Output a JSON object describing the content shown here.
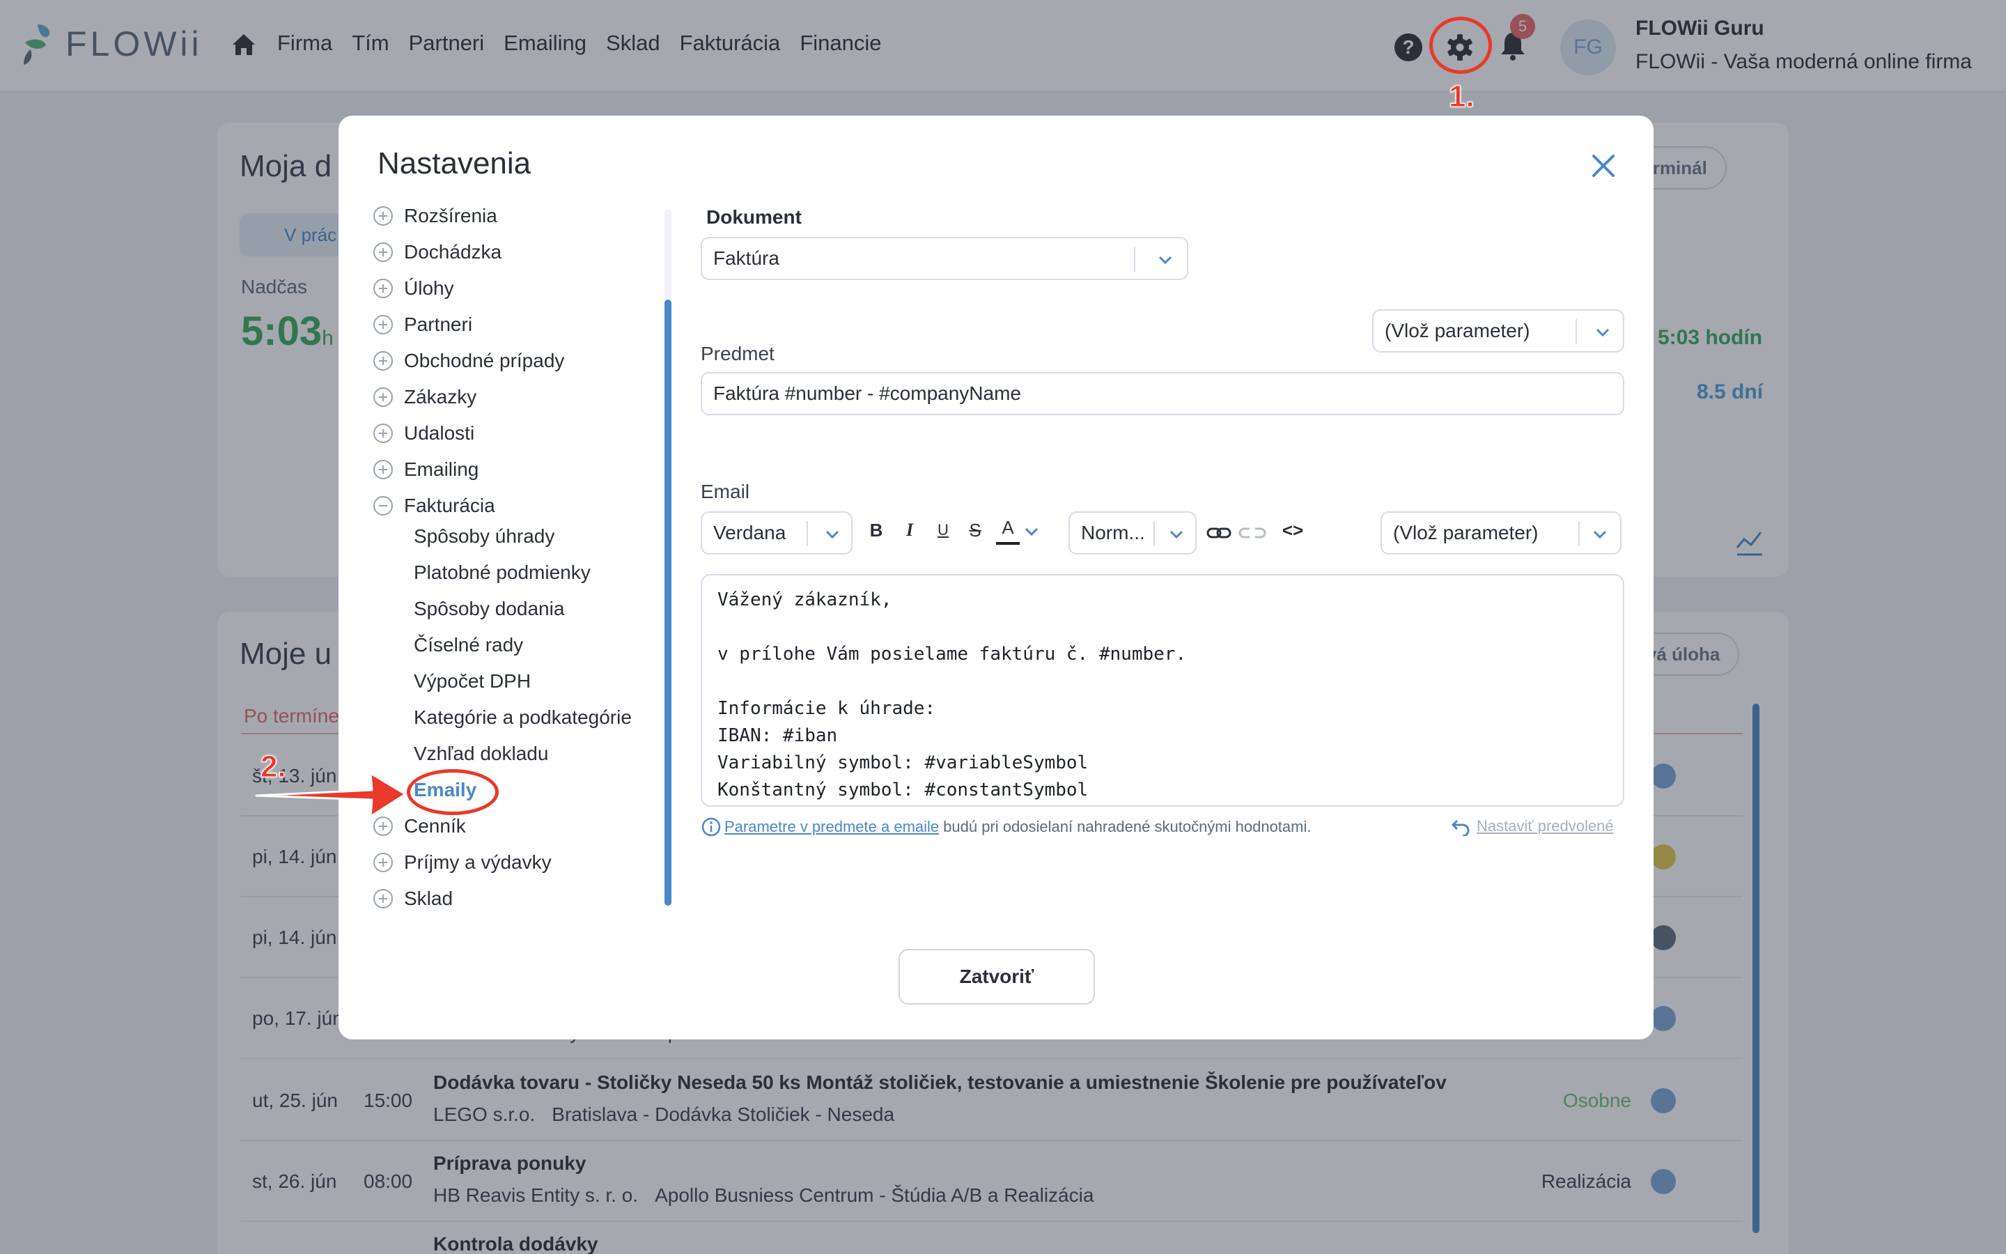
{
  "app": {
    "logo_text": "FLOWii",
    "nav_items": [
      "Firma",
      "Tím",
      "Partneri",
      "Emailing",
      "Sklad",
      "Fakturácia",
      "Financie"
    ],
    "notification_count": "5",
    "avatar_initials": "FG",
    "user_name": "FLOWii Guru",
    "user_company": "FLOWii - Vaša moderná online firma"
  },
  "background": {
    "card1_title": "Moja d",
    "status_chip": "V prác",
    "overtime_label": "Nadčas",
    "overtime_value": "5:03",
    "overtime_unit": "h",
    "terminal_button": "ý terminál",
    "hours_value": "5:03 hodín",
    "days_value": "8.5 dní",
    "card2_title": "Moje u",
    "overdue_label": "Po termíne",
    "new_task_button": "ová úloha",
    "rows": [
      {
        "date": "št, 13. jún",
        "time": "",
        "title": "",
        "partner": "",
        "project": "",
        "tag": ""
      },
      {
        "date": "pi, 14. jún",
        "time": "",
        "title": "",
        "partner": "",
        "project": "",
        "tag": ""
      },
      {
        "date": "pi, 14. jún",
        "time": "",
        "title": "",
        "partner": "",
        "project": "",
        "tag": ""
      },
      {
        "date": "po, 17. jún",
        "time": "",
        "title": "",
        "partner": "HB Reavis Entity s. r. o.",
        "project": "Apollo Busniess Centrum - Štúdia A/B a Realizácia",
        "tag": ""
      },
      {
        "date": "ut, 25. jún",
        "time": "15:00",
        "title": "Dodávka tovaru - Stoličky Neseda 50 ks Montáž stoličiek, testovanie a umiestnenie Školenie pre používateľov",
        "partner": "LEGO s.r.o.",
        "project": "Bratislava - Dodávka Stoličiek - Neseda",
        "tag": "Osobne"
      },
      {
        "date": "st, 26. jún",
        "time": "08:00",
        "title": "Príprava ponuky",
        "partner": "HB Reavis Entity s. r. o.",
        "project": "Apollo Busniess Centrum - Štúdia A/B a Realizácia",
        "tag": "Realizácia"
      },
      {
        "date": "",
        "time": "",
        "title": "Kontrola dodávky",
        "partner": "",
        "project": "",
        "tag": ""
      }
    ]
  },
  "modal": {
    "title": "Nastavenia",
    "tree": {
      "groups": [
        "Rozšírenia",
        "Dochádzka",
        "Úlohy",
        "Partneri",
        "Obchodné prípady",
        "Zákazky",
        "Udalosti",
        "Emailing",
        "Fakturácia"
      ],
      "fakturacia_children": [
        "Spôsoby úhrady",
        "Platobné podmienky",
        "Spôsoby dodania",
        "Číselné rady",
        "Výpočet DPH",
        "Kategórie a podkategórie",
        "Vzhľad dokladu",
        "Emaily"
      ],
      "after_groups": [
        "Cenník",
        "Príjmy a výdavky",
        "Sklad"
      ]
    },
    "document_label": "Dokument",
    "document_value": "Faktúra",
    "insert_param": "(Vlož parameter)",
    "subject_label": "Predmet",
    "subject_value": "Faktúra #number - #companyName",
    "email_label": "Email",
    "font_value": "Verdana",
    "toolbar": {
      "bold": "B",
      "italic": "I",
      "underline": "U",
      "strike": "S",
      "color": "A",
      "link": "⇔",
      "code": "<>"
    },
    "size_value": "Norm...",
    "body_text": "Vážený zákazník,\n\nv prílohe Vám posielame faktúru č. #number.\n\nInformácie k úhrade:\nIBAN: #iban\nVariabilný symbol: #variableSymbol\nKonštantný symbol: #constantSymbol",
    "hint_link": "Parametre v predmete a emaile",
    "hint_rest": "budú pri odosielaní nahradené skutočnými hodnotami.",
    "reset_label": "Nastaviť predvolené",
    "close_button": "Zatvoriť"
  },
  "annotations": {
    "step1": "1.",
    "step2": "2.",
    "color": "#e9392a"
  }
}
